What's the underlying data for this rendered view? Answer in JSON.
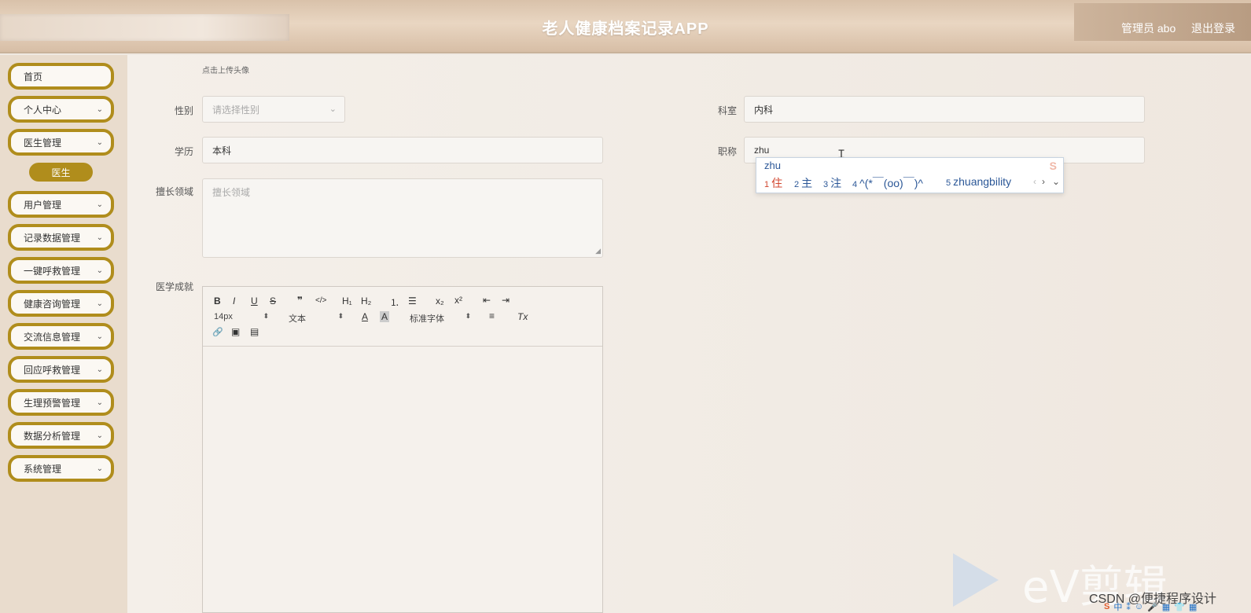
{
  "header": {
    "title": "老人健康档案记录APP",
    "user_label": "管理员 abo",
    "logout": "退出登录"
  },
  "sidebar": {
    "items": [
      {
        "label": "首页",
        "has_chevron": false
      },
      {
        "label": "个人中心",
        "has_chevron": true
      },
      {
        "label": "医生管理",
        "has_chevron": true
      },
      {
        "label": "用户管理",
        "has_chevron": true
      },
      {
        "label": "记录数据管理",
        "has_chevron": true
      },
      {
        "label": "一键呼救管理",
        "has_chevron": true
      },
      {
        "label": "健康咨询管理",
        "has_chevron": true
      },
      {
        "label": "交流信息管理",
        "has_chevron": true
      },
      {
        "label": "回应呼救管理",
        "has_chevron": true
      },
      {
        "label": "生理预警管理",
        "has_chevron": true
      },
      {
        "label": "数据分析管理",
        "has_chevron": true
      },
      {
        "label": "系统管理",
        "has_chevron": true
      }
    ],
    "sub_item": "医生",
    "chevron_glyph": "⌄"
  },
  "form": {
    "avatar_hint": "点击上传头像",
    "gender": {
      "label": "性别",
      "placeholder": "请选择性别"
    },
    "department": {
      "label": "科室",
      "value": "内科"
    },
    "education": {
      "label": "学历",
      "value": "本科"
    },
    "title": {
      "label": "职称",
      "value": "zhu"
    },
    "specialty": {
      "label": "擅长领域",
      "placeholder": "擅长领域"
    },
    "achievements": {
      "label": "医学成就"
    }
  },
  "editor": {
    "font_size": "14px",
    "block_type": "文本",
    "font_family": "标准字体",
    "toolbar_glyphs": {
      "bold": "B",
      "italic": "I",
      "underline": "U",
      "strike": "S",
      "quote": "❞",
      "code": "</>",
      "h1": "H₁",
      "h2": "H₂",
      "ol": "⒈",
      "ul": "☰",
      "sub": "x₂",
      "sup": "x²",
      "outdent": "⇤",
      "indent": "⇥",
      "color": "A",
      "bg": "A",
      "align": "≡",
      "clear": "Tx",
      "link": "🔗",
      "image": "▣",
      "video": "▤"
    }
  },
  "ime": {
    "composition": "zhu",
    "candidates": [
      {
        "num": "1",
        "text": "住"
      },
      {
        "num": "2",
        "text": "主"
      },
      {
        "num": "3",
        "text": "注"
      },
      {
        "num": "4",
        "text": "^(*￣(oo)￣)^"
      },
      {
        "num": "5",
        "text": "zhuangbility"
      }
    ],
    "prev": "‹",
    "next": "›",
    "expand": "⌄",
    "logo": "S"
  },
  "watermark": {
    "brand": "eV剪辑",
    "csdn": "CSDN @便捷程序设计"
  },
  "tray": {
    "items": [
      "S",
      "中",
      "⁑",
      "☺",
      "🎤",
      "▦",
      "👕",
      "▦"
    ]
  }
}
